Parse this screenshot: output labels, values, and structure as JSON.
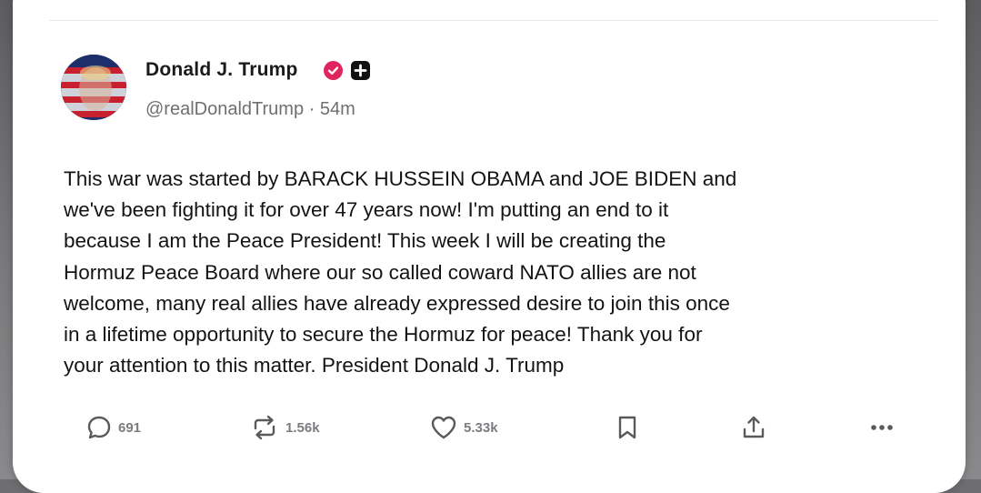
{
  "post": {
    "author_name": "Donald J. Trump",
    "handle": "@realDonaldTrump",
    "separator": "·",
    "time": "54m",
    "body_lines": [
      "This war was started by BARACK HUSSEIN OBAMA and JOE BIDEN and",
      "we've been fighting it for over 47 years now! I'm putting an end to it",
      "because I am the Peace President! This week I will be creating the",
      "Hormuz Peace Board where our so called coward NATO allies are not",
      "welcome, many real allies have already expressed desire to join this once",
      "in a lifetime opportunity to secure the Hormuz for peace! Thank you for",
      "your attention to this matter. President Donald J. Trump"
    ]
  },
  "actions": {
    "reply_count": "691",
    "repost_count": "1.56k",
    "like_count": "5.33k"
  },
  "colors": {
    "verified": "#e0245e",
    "text": "#141414",
    "muted": "#6f6f72",
    "icon": "#5a5a5e"
  },
  "icons": [
    "reply-icon",
    "repost-icon",
    "heart-icon",
    "bookmark-icon",
    "share-icon",
    "more-icon",
    "verified-icon",
    "plus-icon"
  ]
}
